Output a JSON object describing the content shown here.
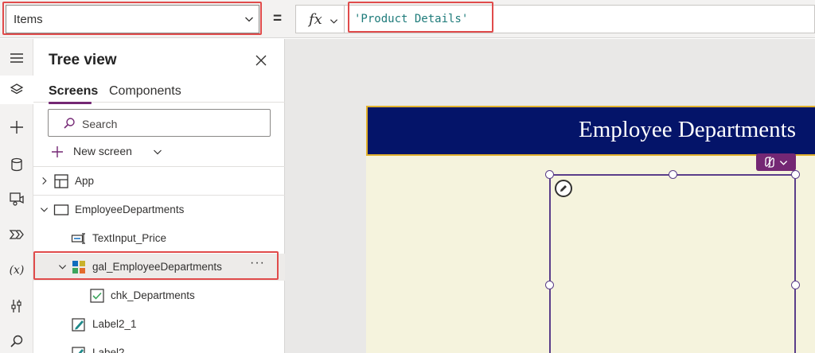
{
  "formula_bar": {
    "property": "Items",
    "equals": "=",
    "fx": "fx",
    "formula": "'Product Details'"
  },
  "left_rail": {
    "items": [
      {
        "icon": "hamburger-menu-icon"
      },
      {
        "icon": "layers-icon",
        "active": true
      },
      {
        "icon": "plus-icon"
      },
      {
        "icon": "data-cylinder-icon"
      },
      {
        "icon": "media-icon"
      },
      {
        "icon": "power-automate-icon"
      },
      {
        "icon": "variables-icon",
        "text": "(x)"
      },
      {
        "icon": "advanced-tools-icon"
      },
      {
        "icon": "search-icon"
      }
    ]
  },
  "tree_view": {
    "title": "Tree view",
    "tabs": [
      {
        "label": "Screens",
        "active": true
      },
      {
        "label": "Components",
        "active": false
      }
    ],
    "search_placeholder": "Search",
    "new_screen_label": "New screen",
    "nodes": [
      {
        "label": "App",
        "icon": "app-icon"
      },
      {
        "label": "EmployeeDepartments",
        "icon": "screen-icon"
      },
      {
        "label": "TextInput_Price",
        "icon": "text-input-icon"
      },
      {
        "label": "gal_EmployeeDepartments",
        "icon": "gallery-icon",
        "selected": true,
        "more": "···"
      },
      {
        "label": "chk_Departments",
        "icon": "checkbox-icon"
      },
      {
        "label": "Label2_1",
        "icon": "label-icon"
      },
      {
        "label": "Label2",
        "icon": "label-icon"
      }
    ]
  },
  "canvas": {
    "header_title": "Employee Departments",
    "colors": {
      "header_bg": "#041469",
      "header_border": "#e1b12c",
      "screen_bg": "#f5f3dd",
      "selection": "#5a3d8a",
      "accent": "#742774",
      "highlight_box": "#e04b4b"
    }
  }
}
